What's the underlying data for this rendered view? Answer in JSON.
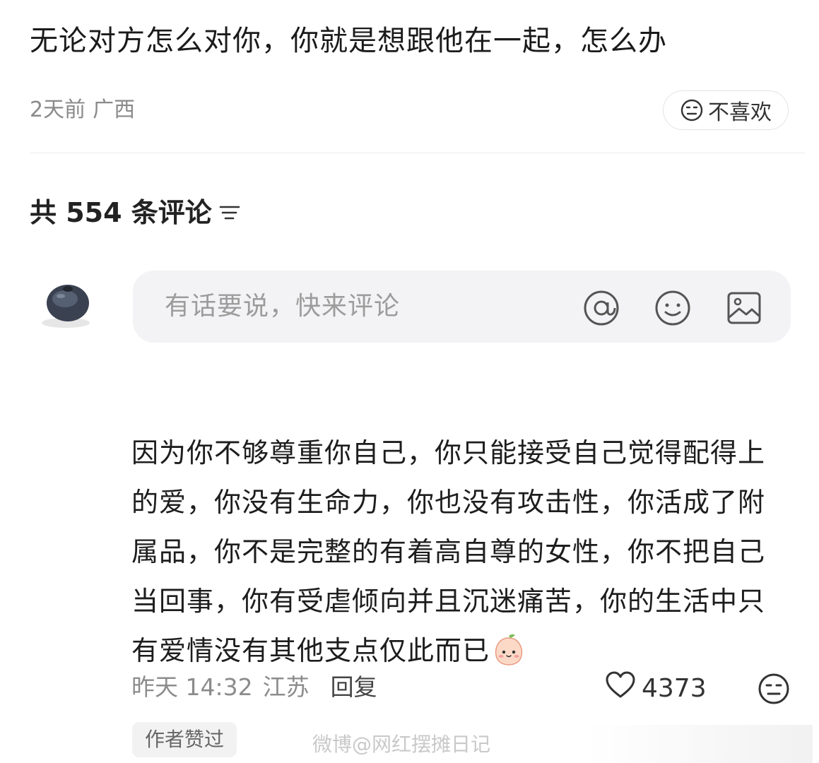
{
  "post": {
    "title": "无论对方怎么对你，你就是想跟他在一起，怎么办",
    "time": "2天前",
    "location": "广西",
    "dislike_label": "不喜欢"
  },
  "comments_section": {
    "count_text": "共 554 条评论"
  },
  "input": {
    "placeholder": "有话要说，快来评论"
  },
  "icons": {
    "sort": "sort-icon",
    "mention": "at-icon",
    "emoji": "emoji-icon",
    "image": "image-icon",
    "like": "heart-icon",
    "dislike": "dislike-face-icon"
  },
  "comment": {
    "text": "因为你不够尊重你自己，你只能接受自己觉得配得上的爱，你没有生命力，你也没有攻击性，你活成了附属品，你不是完整的有着高自尊的女性，你不把自己当回事，你有受虐倾向并且沉迷痛苦，你的生活中只有爱情没有其他支点仅此而已",
    "time": "昨天 14:32",
    "location": "江苏",
    "reply_label": "回复",
    "likes": "4373",
    "badge": "作者赞过"
  },
  "watermark": "微博@网红摆摊日记"
}
